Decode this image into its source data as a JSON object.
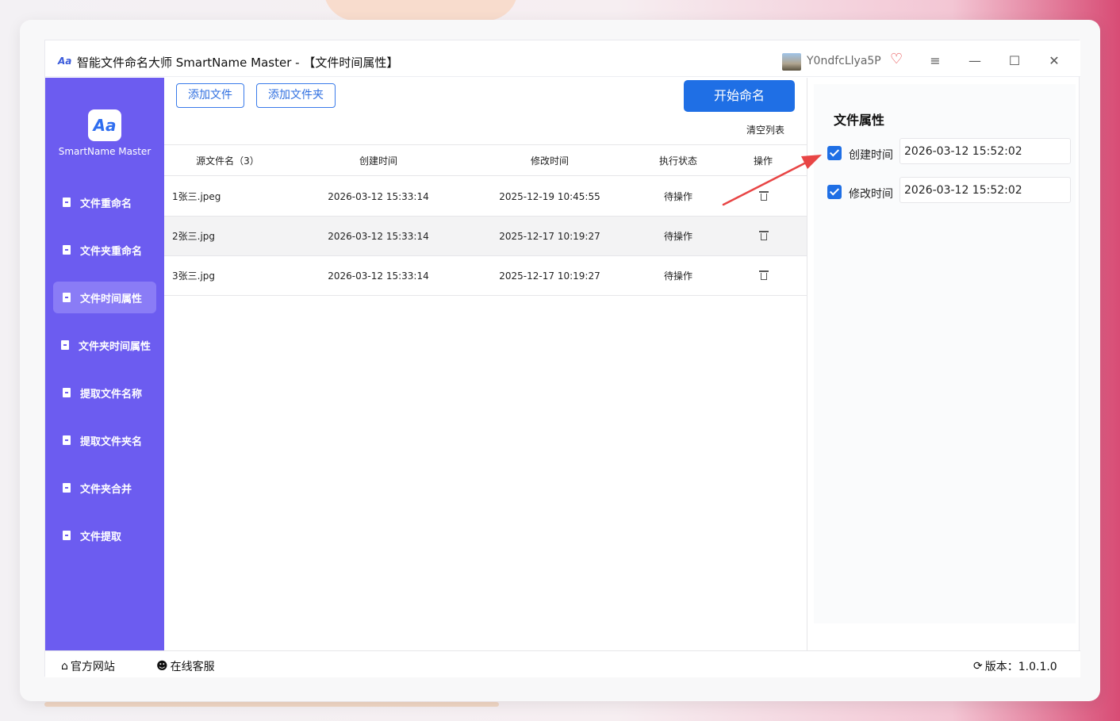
{
  "window": {
    "title": "智能文件命名大师 SmartName Master - 【文件时间属性】",
    "username": "Y0ndfcLlya5P",
    "controls": {
      "menu": "≡",
      "minimize": "—",
      "maximize": "☐",
      "close": "✕"
    }
  },
  "sidebar": {
    "logo_text": "Aa",
    "brand": "SmartName Master",
    "items": [
      {
        "label": "文件重命名",
        "active": false
      },
      {
        "label": "文件夹重命名",
        "active": false
      },
      {
        "label": "文件时间属性",
        "active": true
      },
      {
        "label": "文件夹时间属性",
        "active": false
      },
      {
        "label": "提取文件名称",
        "active": false
      },
      {
        "label": "提取文件夹名",
        "active": false
      },
      {
        "label": "文件夹合并",
        "active": false
      },
      {
        "label": "文件提取",
        "active": false
      }
    ]
  },
  "toolbar": {
    "add_file": "添加文件",
    "add_folder": "添加文件夹",
    "start": "开始命名",
    "clear": "清空列表"
  },
  "table": {
    "headers": [
      "源文件名（3）",
      "创建时间",
      "修改时间",
      "执行状态",
      "操作"
    ],
    "rows": [
      {
        "name": "1张三.jpeg",
        "created": "2026-03-12 15:33:14",
        "modified": "2025-12-19 10:45:55",
        "status": "待操作"
      },
      {
        "name": "2张三.jpg",
        "created": "2026-03-12 15:33:14",
        "modified": "2025-12-17 10:19:27",
        "status": "待操作"
      },
      {
        "name": "3张三.jpg",
        "created": "2026-03-12 15:33:14",
        "modified": "2025-12-17 10:19:27",
        "status": "待操作"
      }
    ]
  },
  "panel": {
    "title": "文件属性",
    "created_label": "创建时间",
    "created_value": "2026-03-12 15:52:02",
    "modified_label": "修改时间",
    "modified_value": "2026-03-12 15:52:02"
  },
  "footer": {
    "website": "官方网站",
    "support": "在线客服",
    "version": "版本：1.0.1.0"
  },
  "colors": {
    "sidebar": "#6c5cf0",
    "primary": "#1f6fe5",
    "arrow": "#e84545"
  }
}
